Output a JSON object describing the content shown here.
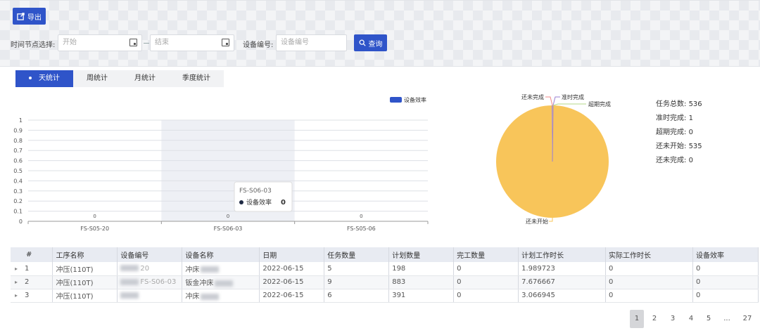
{
  "toolbar": {
    "export_label": "导出"
  },
  "filters": {
    "time_label": "时间节点选择:",
    "start_placeholder": "开始",
    "end_placeholder": "结束",
    "device_label": "设备编号:",
    "device_placeholder": "设备编号",
    "query_label": "查询"
  },
  "tabs": [
    {
      "label": "天统计",
      "active": true
    },
    {
      "label": "周统计",
      "active": false
    },
    {
      "label": "月统计",
      "active": false
    },
    {
      "label": "季度统计",
      "active": false
    }
  ],
  "chart_data": [
    {
      "type": "bar",
      "categories": [
        "FS-S05-20",
        "FS-S06-03",
        "FS-S05-06"
      ],
      "series": [
        {
          "name": "设备效率",
          "values": [
            0,
            0,
            0
          ],
          "color": "#2f54c9"
        }
      ],
      "ylim": [
        0,
        1
      ],
      "yticks": [
        "0",
        "0.1",
        "0.2",
        "0.3",
        "0.4",
        "0.5",
        "0.6",
        "0.7",
        "0.8",
        "0.9",
        "1"
      ],
      "grid": true,
      "legend": "top-right",
      "tooltip": {
        "title": "FS-S06-03",
        "series": "设备效率",
        "value": "0"
      }
    },
    {
      "type": "pie",
      "labels": [
        "还未开始",
        "准时完成",
        "超期完成",
        "还未完成"
      ],
      "values": [
        535,
        1,
        0,
        0
      ],
      "colors": [
        "#f8c55a",
        "#9a7fd1",
        "#e5e5e5",
        "#e5e5e5"
      ]
    }
  ],
  "stats": [
    {
      "label": "任务总数:",
      "value": "536"
    },
    {
      "label": "准时完成:",
      "value": "1"
    },
    {
      "label": "超期完成:",
      "value": "0"
    },
    {
      "label": "还未开始:",
      "value": "535"
    },
    {
      "label": "还未完成:",
      "value": "0"
    }
  ],
  "table": {
    "headers": [
      "#",
      "工序名称",
      "设备编号",
      "设备名称",
      "日期",
      "任务数量",
      "计划数量",
      "完工数量",
      "计划工作时长",
      "实际工作时长",
      "设备效率"
    ],
    "rows": [
      {
        "index": "1",
        "process": "冲压(110T)",
        "device_no": "20",
        "device_name": "冲床",
        "date": "2022-06-15",
        "tasks": "5",
        "planned": "198",
        "done": "0",
        "plan_hours": "1.989723",
        "actual_hours": "0",
        "efficiency": "0"
      },
      {
        "index": "2",
        "process": "冲压(110T)",
        "device_no": "FS-S06-03",
        "device_name": "钣金冲床",
        "date": "2022-06-15",
        "tasks": "9",
        "planned": "883",
        "done": "0",
        "plan_hours": "7.676667",
        "actual_hours": "0",
        "efficiency": "0"
      },
      {
        "index": "3",
        "process": "冲压(110T)",
        "device_no": "",
        "device_name": "冲床",
        "date": "2022-06-15",
        "tasks": "6",
        "planned": "391",
        "done": "0",
        "plan_hours": "3.066945",
        "actual_hours": "0",
        "efficiency": "0"
      }
    ]
  },
  "pagination": {
    "pages": [
      "1",
      "2",
      "3",
      "4",
      "5",
      "...",
      "27"
    ],
    "current": "1"
  }
}
